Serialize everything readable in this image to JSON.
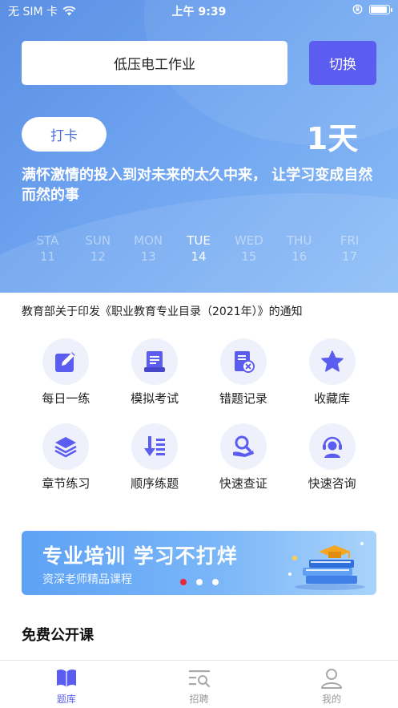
{
  "status_bar": {
    "carrier": "无 SIM 卡",
    "time": "上午 9:39"
  },
  "header": {
    "subject": "低压电工作业",
    "switch_label": "切换",
    "checkin_label": "打卡",
    "days_count": "1天",
    "motto": "满怀激情的投入到对未来的太久中来， 让学习变成自然而然的事"
  },
  "week": [
    {
      "name": "STA",
      "date": "11"
    },
    {
      "name": "SUN",
      "date": "12"
    },
    {
      "name": "MON",
      "date": "13"
    },
    {
      "name": "TUE",
      "date": "14",
      "active": true
    },
    {
      "name": "WED",
      "date": "15"
    },
    {
      "name": "THU",
      "date": "16"
    },
    {
      "name": "FRI",
      "date": "17"
    }
  ],
  "notice": "教育部关于印发《职业教育专业目录（2021年）》的通知",
  "features": [
    {
      "label": "每日一练",
      "icon": "edit-icon"
    },
    {
      "label": "模拟考试",
      "icon": "document-icon"
    },
    {
      "label": "错题记录",
      "icon": "error-record-icon"
    },
    {
      "label": "收藏库",
      "icon": "star-icon"
    },
    {
      "label": "章节练习",
      "icon": "layers-icon"
    },
    {
      "label": "顺序练题",
      "icon": "sequence-icon"
    },
    {
      "label": "快速查证",
      "icon": "search-hand-icon"
    },
    {
      "label": "快速咨询",
      "icon": "headset-icon"
    }
  ],
  "banner": {
    "title": "专业培训  学习不打烊",
    "subtitle": "资深老师精品课程",
    "slides": 3,
    "current_slide": 1
  },
  "section": {
    "title": "免费公开课"
  },
  "tabbar": [
    {
      "label": "题库",
      "icon": "book-icon",
      "active": true
    },
    {
      "label": "招聘",
      "icon": "search-list-icon"
    },
    {
      "label": "我的",
      "icon": "user-icon"
    }
  ],
  "colors": {
    "accent": "#5b5cf0",
    "hero_blue": "#6ea4f0",
    "icon_bg": "#eef0fb",
    "dot_active": "#e5283a"
  }
}
